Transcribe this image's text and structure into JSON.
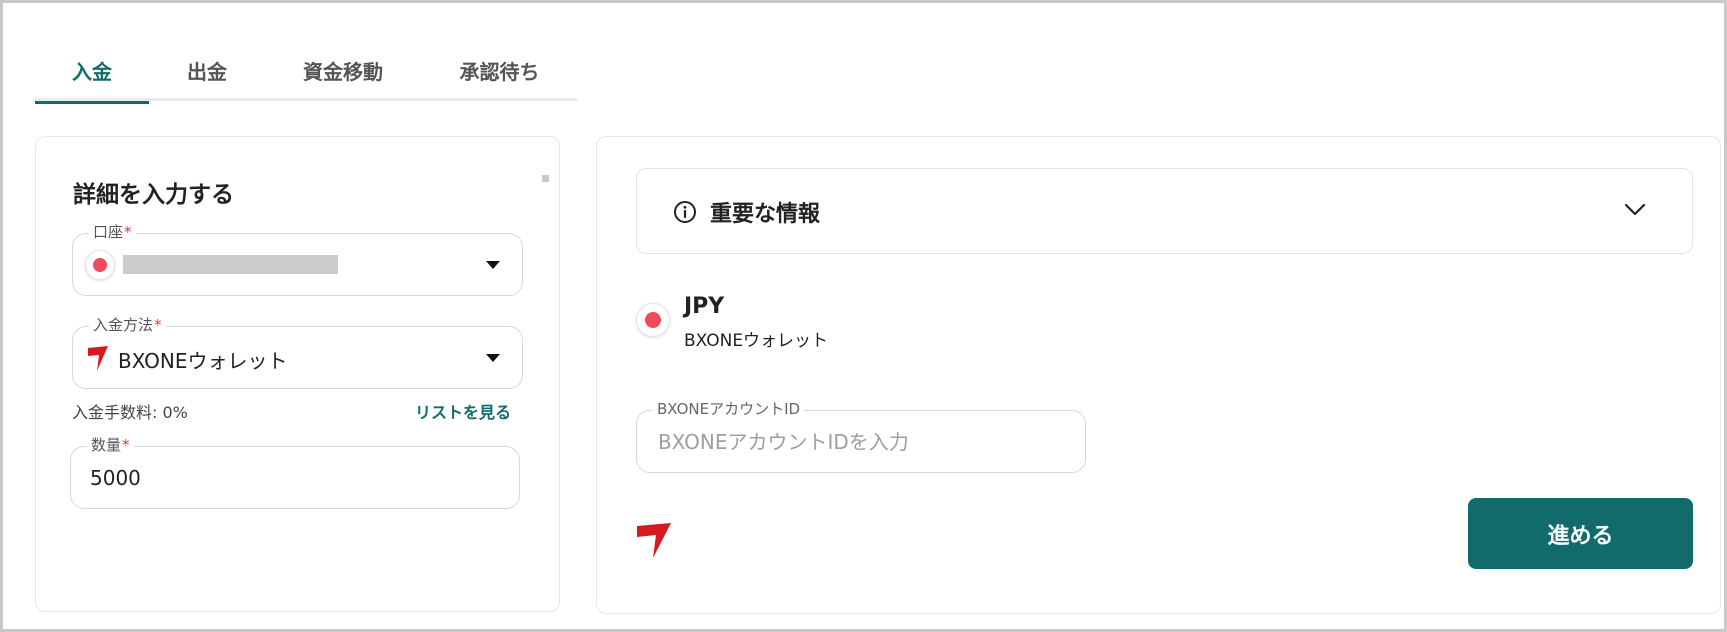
{
  "tabs": [
    {
      "label": "入金",
      "active": true
    },
    {
      "label": "出金",
      "active": false
    },
    {
      "label": "資金移動",
      "active": false
    },
    {
      "label": "承認待ち",
      "active": false
    }
  ],
  "details": {
    "title": "詳細を入力する",
    "account": {
      "label": "口座",
      "required_mark": "*",
      "value_masked": true
    },
    "deposit_method": {
      "label": "入金方法",
      "required_mark": "*",
      "value": "BXONEウォレット"
    },
    "fee_text": "入金手数料: 0%",
    "list_link": "リストを見る",
    "quantity": {
      "label": "数量",
      "required_mark": "*",
      "value": "5000"
    }
  },
  "info_panel": {
    "title": "重要な情報",
    "icon": "info-icon",
    "expand_icon": "chevron-down-icon"
  },
  "summary": {
    "currency": "JPY",
    "method": "BXONEウォレット"
  },
  "bxone_account": {
    "label": "BXONEアカウントID",
    "placeholder": "BXONEアカウントIDを入力",
    "value": ""
  },
  "proceed_button": "進める",
  "colors": {
    "accent": "#116b6a",
    "currency_dot": "#ef4b5a",
    "brand_red": "#d71920",
    "required": "#e53935"
  }
}
